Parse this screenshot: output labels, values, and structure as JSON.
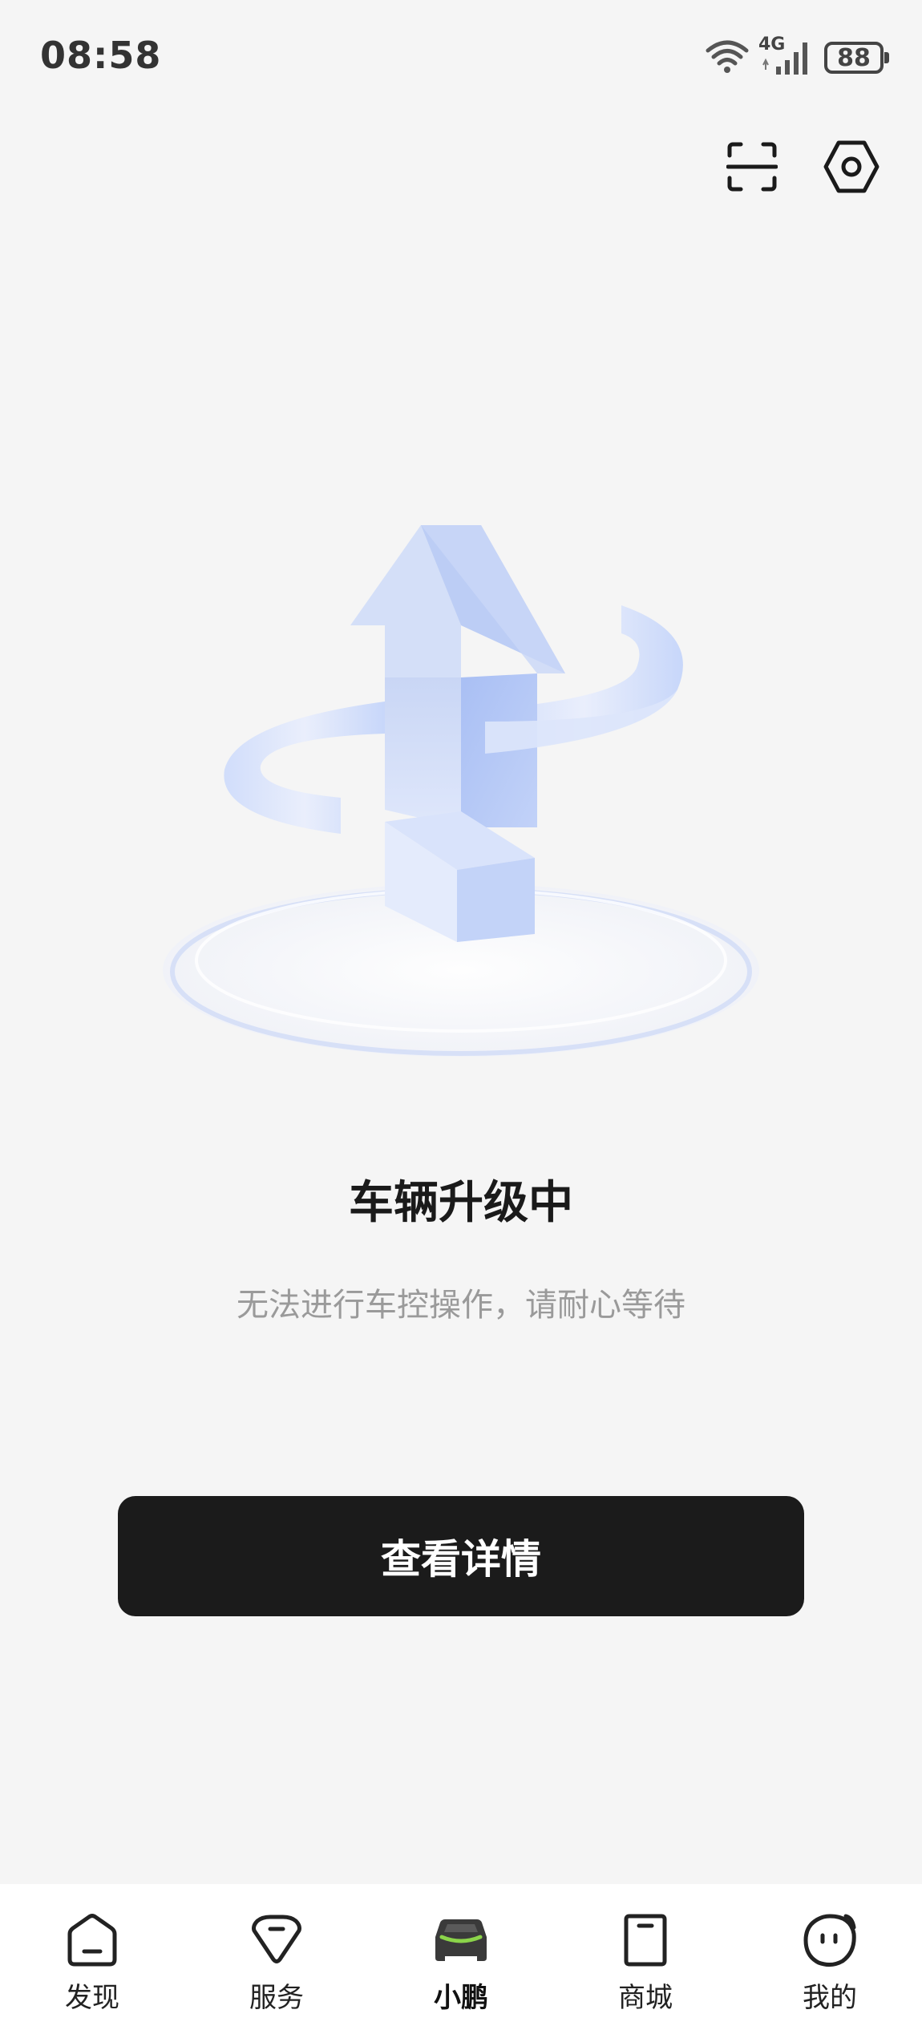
{
  "status_bar": {
    "time": "08:58",
    "network": "4G",
    "battery": "88",
    "icons": [
      "wifi-icon",
      "signal-icon",
      "battery-icon"
    ]
  },
  "top_actions": [
    {
      "name": "scan-icon"
    },
    {
      "name": "settings-icon"
    }
  ],
  "main": {
    "illustration": "upgrade-arrow-illustration",
    "title": "车辆升级中",
    "subtitle": "无法进行车控操作，请耐心等待",
    "button_label": "查看详情"
  },
  "tabbar": {
    "items": [
      {
        "label": "发现",
        "icon": "discover-icon",
        "active": false
      },
      {
        "label": "服务",
        "icon": "service-icon",
        "active": false
      },
      {
        "label": "小鹏",
        "icon": "car-icon",
        "active": true
      },
      {
        "label": "商城",
        "icon": "shop-icon",
        "active": false
      },
      {
        "label": "我的",
        "icon": "profile-icon",
        "active": false
      }
    ]
  },
  "colors": {
    "background": "#f5f5f5",
    "button": "#1b1b1b",
    "accent_green": "#8bd44a",
    "illustration_blue": "#b9cdf7"
  }
}
